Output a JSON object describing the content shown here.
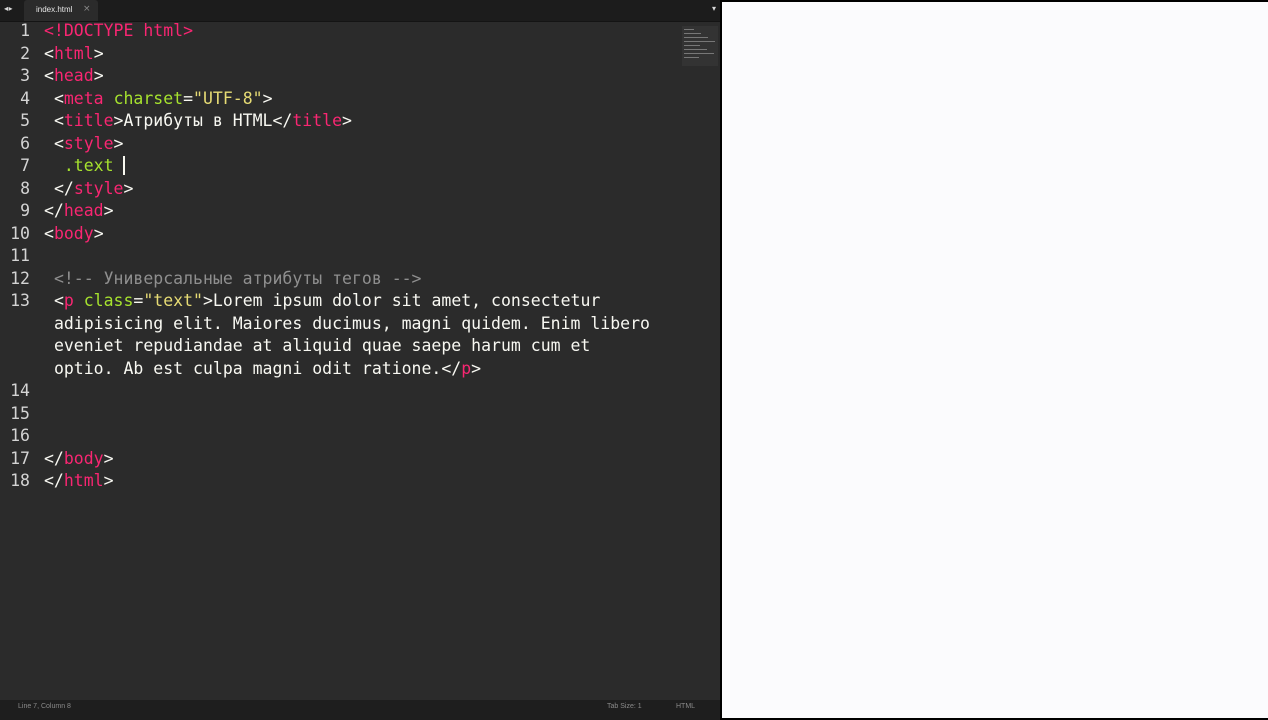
{
  "tab": {
    "nav_label": "◂ ▸",
    "file_name": "index.html",
    "close_label": "×",
    "dropdown_label": "▾"
  },
  "lines": [
    {
      "num": "1",
      "tokens": [
        {
          "t": "tag",
          "v": "<!DOCTYPE html>"
        }
      ]
    },
    {
      "num": "2",
      "tokens": [
        {
          "t": "txt",
          "v": "<"
        },
        {
          "t": "tag",
          "v": "html"
        },
        {
          "t": "txt",
          "v": ">"
        }
      ]
    },
    {
      "num": "3",
      "tokens": [
        {
          "t": "txt",
          "v": "<"
        },
        {
          "t": "tag",
          "v": "head"
        },
        {
          "t": "txt",
          "v": ">"
        }
      ]
    },
    {
      "num": "4",
      "tokens": [
        {
          "t": "txt",
          "v": " <"
        },
        {
          "t": "tag",
          "v": "meta"
        },
        {
          "t": "txt",
          "v": " "
        },
        {
          "t": "attr",
          "v": "charset"
        },
        {
          "t": "txt",
          "v": "="
        },
        {
          "t": "str",
          "v": "\"UTF-8\""
        },
        {
          "t": "txt",
          "v": ">"
        }
      ]
    },
    {
      "num": "5",
      "tokens": [
        {
          "t": "txt",
          "v": " <"
        },
        {
          "t": "tag",
          "v": "title"
        },
        {
          "t": "txt",
          "v": ">Атрибуты в HTML</"
        },
        {
          "t": "tag",
          "v": "title"
        },
        {
          "t": "txt",
          "v": ">"
        }
      ]
    },
    {
      "num": "6",
      "tokens": [
        {
          "t": "txt",
          "v": " <"
        },
        {
          "t": "tag",
          "v": "style"
        },
        {
          "t": "txt",
          "v": ">"
        }
      ]
    },
    {
      "num": "7",
      "tokens": [
        {
          "t": "txt",
          "v": "  "
        },
        {
          "t": "cls",
          "v": ".text"
        },
        {
          "t": "txt",
          "v": " "
        }
      ],
      "cursor": true
    },
    {
      "num": "8",
      "tokens": [
        {
          "t": "txt",
          "v": " </"
        },
        {
          "t": "tag",
          "v": "style"
        },
        {
          "t": "txt",
          "v": ">"
        }
      ]
    },
    {
      "num": "9",
      "tokens": [
        {
          "t": "txt",
          "v": "</"
        },
        {
          "t": "tag",
          "v": "head"
        },
        {
          "t": "txt",
          "v": ">"
        }
      ]
    },
    {
      "num": "10",
      "tokens": [
        {
          "t": "txt",
          "v": "<"
        },
        {
          "t": "tag",
          "v": "body"
        },
        {
          "t": "txt",
          "v": ">"
        }
      ]
    },
    {
      "num": "11",
      "tokens": []
    },
    {
      "num": "12",
      "tokens": [
        {
          "t": "comment",
          "v": " <!-- Универсальные атрибуты тегов -->"
        }
      ]
    },
    {
      "num": "13",
      "tokens": [
        {
          "t": "txt",
          "v": " <"
        },
        {
          "t": "tag",
          "v": "p"
        },
        {
          "t": "txt",
          "v": " "
        },
        {
          "t": "attr",
          "v": "class"
        },
        {
          "t": "txt",
          "v": "="
        },
        {
          "t": "str",
          "v": "\"text\""
        },
        {
          "t": "txt",
          "v": ">Lorem ipsum dolor sit amet, consectetur\n adipisicing elit. Maiores ducimus, magni quidem. Enim libero\n eveniet repudiandae at aliquid quae saepe harum cum et\n optio. Ab est culpa magni odit ratione.</"
        },
        {
          "t": "tag",
          "v": "p"
        },
        {
          "t": "txt",
          "v": ">"
        }
      ]
    },
    {
      "num": "14",
      "tokens": []
    },
    {
      "num": "15",
      "tokens": []
    },
    {
      "num": "16",
      "tokens": []
    },
    {
      "num": "17",
      "tokens": [
        {
          "t": "txt",
          "v": "</"
        },
        {
          "t": "tag",
          "v": "body"
        },
        {
          "t": "txt",
          "v": ">"
        }
      ]
    },
    {
      "num": "18",
      "tokens": [
        {
          "t": "txt",
          "v": "</"
        },
        {
          "t": "tag",
          "v": "html"
        },
        {
          "t": "txt",
          "v": ">"
        }
      ]
    }
  ],
  "status": {
    "position": "Line 7, Column 8",
    "tab_size": "Tab Size: 1",
    "syntax": "HTML"
  },
  "colors": {
    "tag": "#f92672",
    "attr": "#a6e22e",
    "string": "#e6db74",
    "comment": "#8f8f8f",
    "background": "#2b2b2b"
  }
}
